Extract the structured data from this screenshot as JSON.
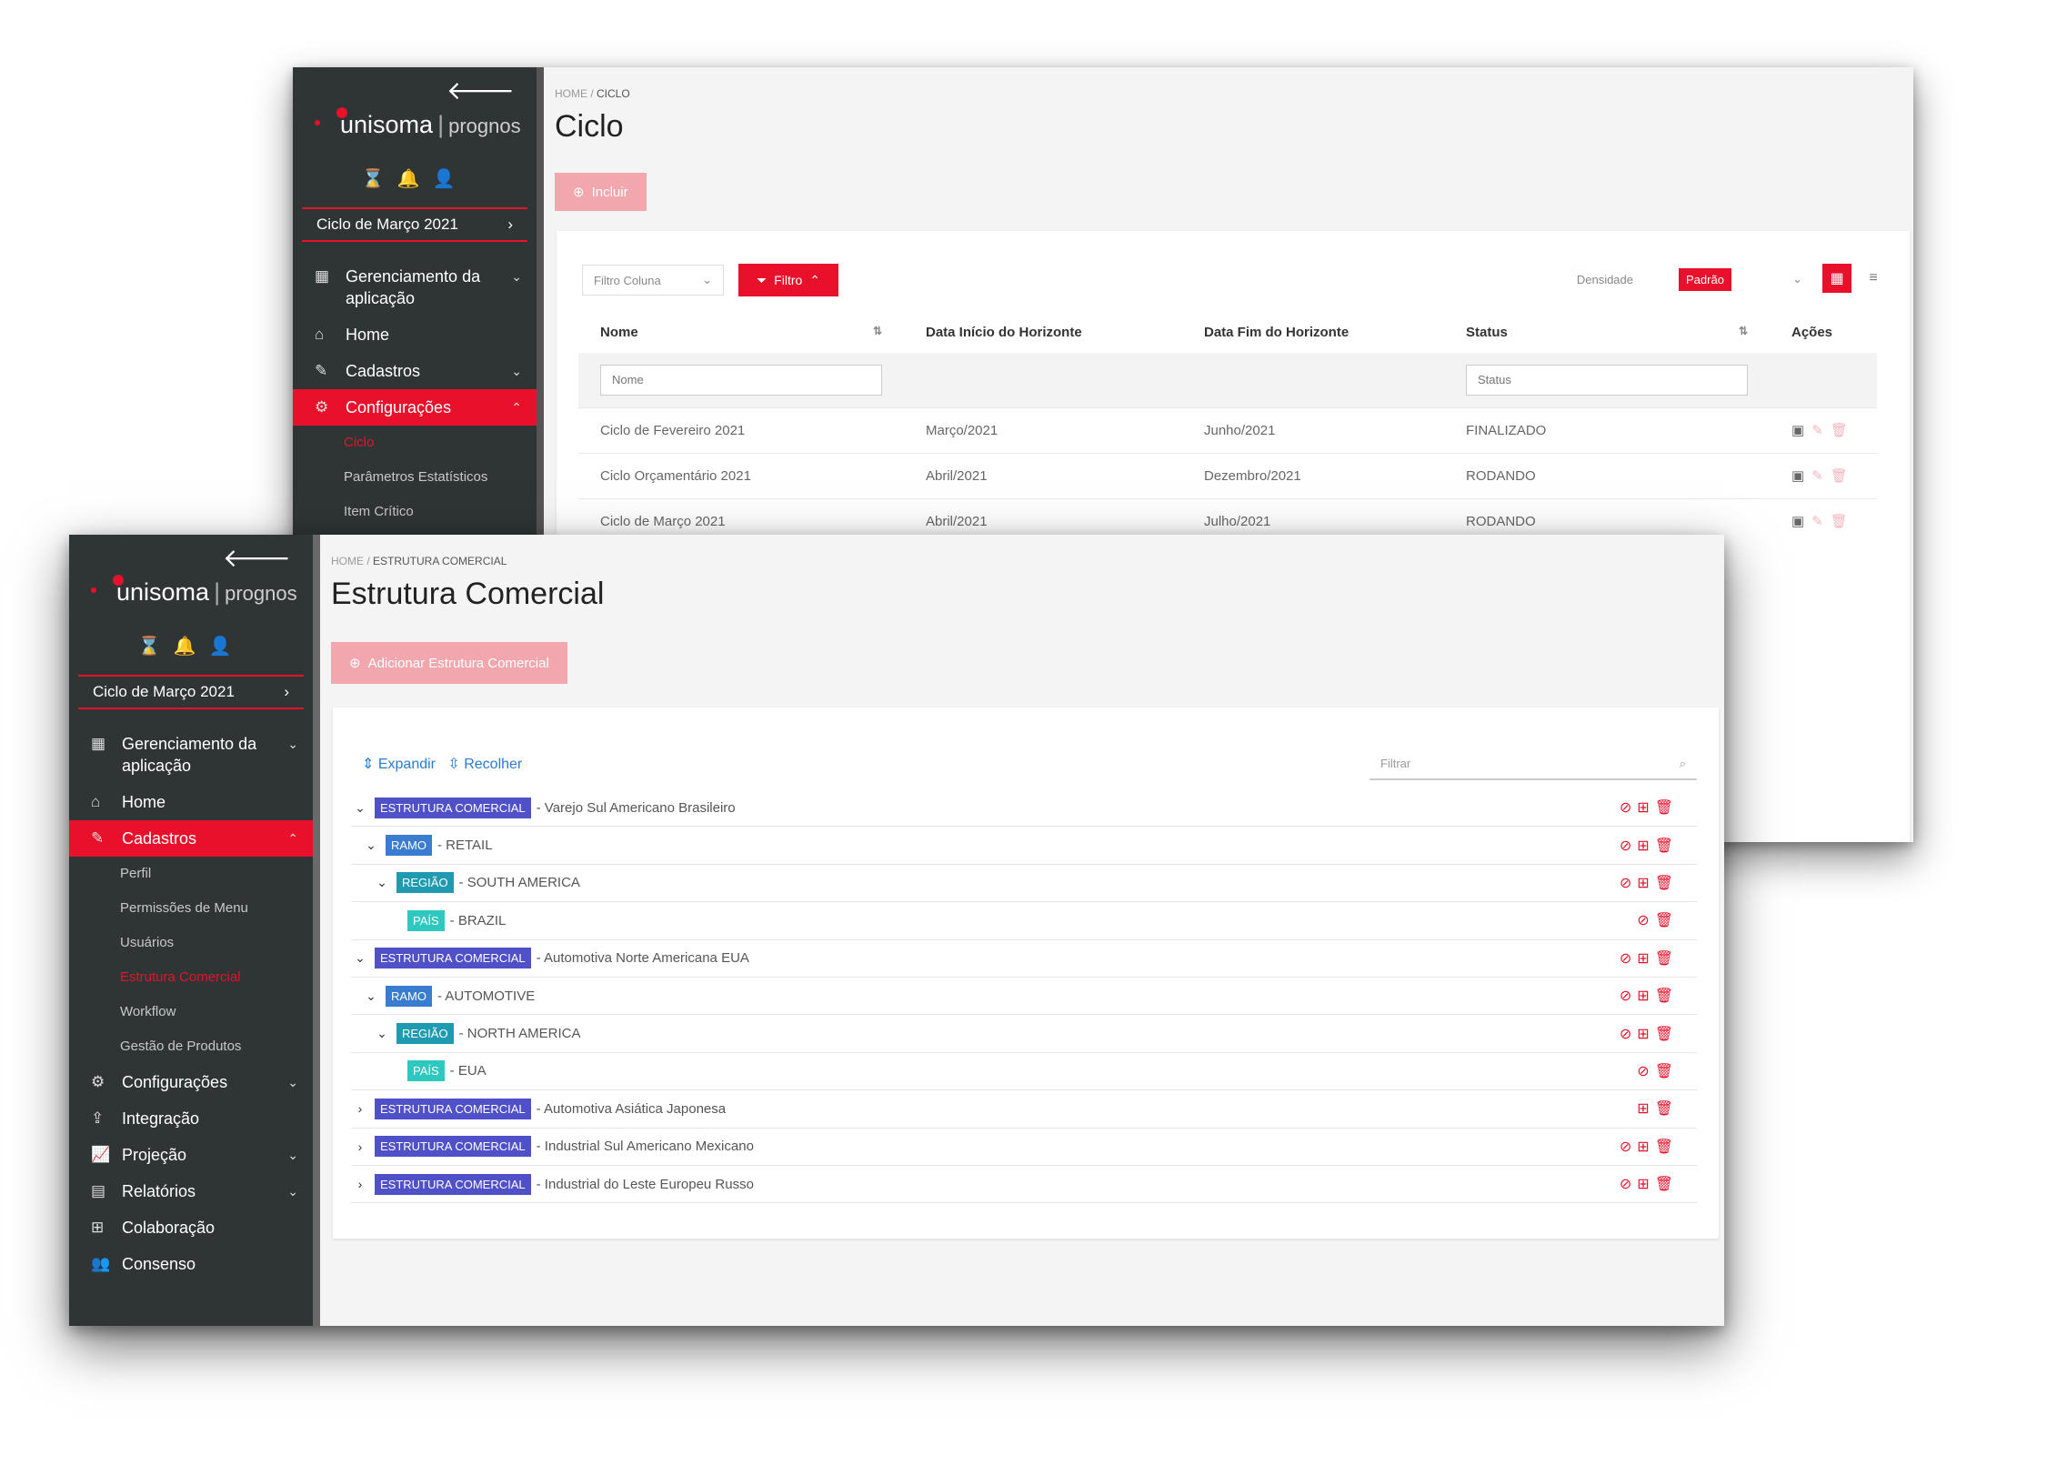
{
  "back_window": {
    "sidebar": {
      "back_icon": "arrow-left-icon",
      "logo": {
        "brand": "unisoma",
        "product": "prognos"
      },
      "cycle": {
        "label": "Ciclo de Março 2021"
      },
      "nav": [
        {
          "label": "Gerenciamento da aplicação",
          "icon": "grid-icon",
          "chevron": "down",
          "active": false
        },
        {
          "label": "Home",
          "icon": "home-icon",
          "active": false
        },
        {
          "label": "Cadastros",
          "icon": "edit-icon",
          "chevron": "down",
          "active": false
        },
        {
          "label": "Configurações",
          "icon": "gears-icon",
          "chevron": "up",
          "active": true
        }
      ],
      "sub_items": [
        "Ciclo",
        "Parâmetros Estatísticos",
        "Item Crítico"
      ]
    },
    "breadcrumb": {
      "home": "HOME",
      "current": "CICLO"
    },
    "title": "Ciclo",
    "add_button": "Incluir",
    "toolbar": {
      "column_filter": "Filtro Coluna",
      "filter_button": "Filtro",
      "density_label": "Densidade",
      "density_value": "Padrão"
    },
    "table": {
      "headers": [
        "Nome",
        "Data Início do Horizonte",
        "Data Fim do Horizonte",
        "Status",
        "Ações"
      ],
      "filter_placeholders": {
        "name": "Nome",
        "status": "Status"
      },
      "rows": [
        {
          "name": "Ciclo de Fevereiro 2021",
          "start": "Março/2021",
          "end": "Junho/2021",
          "status": "FINALIZADO"
        },
        {
          "name": "Ciclo Orçamentário 2021",
          "start": "Abril/2021",
          "end": "Dezembro/2021",
          "status": "RODANDO"
        },
        {
          "name": "Ciclo de Março 2021",
          "start": "Abril/2021",
          "end": "Julho/2021",
          "status": "RODANDO"
        }
      ]
    }
  },
  "front_window": {
    "sidebar": {
      "back_icon": "arrow-left-icon",
      "logo": {
        "brand": "unisoma",
        "product": "prognos"
      },
      "cycle": {
        "label": "Ciclo de Março 2021"
      },
      "nav_top": [
        {
          "label": "Gerenciamento da aplicação",
          "icon": "grid-icon"
        },
        {
          "label": "Home",
          "icon": "home-icon"
        },
        {
          "label": "Cadastros",
          "icon": "edit-icon"
        }
      ],
      "sub_items": [
        "Perfil",
        "Permissões de Menu",
        "Usuários",
        "Estrutura Comercial",
        "Workflow",
        "Gestão de Produtos"
      ],
      "nav_bottom": [
        {
          "label": "Configurações",
          "icon": "gears-icon"
        },
        {
          "label": "Integração",
          "icon": "upload-icon"
        },
        {
          "label": "Projeção",
          "icon": "chart-icon"
        },
        {
          "label": "Relatórios",
          "icon": "document-icon"
        },
        {
          "label": "Colaboração",
          "icon": "sitemap-icon"
        },
        {
          "label": "Consenso",
          "icon": "users-icon"
        }
      ]
    },
    "breadcrumb": {
      "home": "HOME",
      "current": "ESTRUTURA COMERCIAL"
    },
    "title": "Estrutura Comercial",
    "add_button": "Adicionar Estrutura Comercial",
    "tree_tools": {
      "expand": "Expandir",
      "collapse": "Recolher",
      "filter_placeholder": "Filtrar"
    },
    "tree": [
      {
        "level": 0,
        "toggle": "⌄",
        "tag": "ESTRUTURA COMERCIAL",
        "type": "estrutura",
        "text": "- Varejo Sul Americano Brasileiro",
        "actions": [
          "block",
          "add",
          "delete"
        ]
      },
      {
        "level": 1,
        "toggle": "⌄",
        "tag": "RAMO",
        "type": "ramo",
        "text": "- RETAIL",
        "actions": [
          "block",
          "add",
          "delete"
        ]
      },
      {
        "level": 2,
        "toggle": "⌄",
        "tag": "REGIÃO",
        "type": "regiao",
        "text": "- SOUTH AMERICA",
        "actions": [
          "block",
          "add",
          "delete"
        ]
      },
      {
        "level": 3,
        "toggle": "",
        "tag": "PAÍS",
        "type": "pais",
        "text": "- BRAZIL",
        "actions": [
          "block",
          "delete"
        ]
      },
      {
        "level": 0,
        "toggle": "⌄",
        "tag": "ESTRUTURA COMERCIAL",
        "type": "estrutura",
        "text": "- Automotiva Norte Americana EUA",
        "actions": [
          "block",
          "add",
          "delete"
        ]
      },
      {
        "level": 1,
        "toggle": "⌄",
        "tag": "RAMO",
        "type": "ramo",
        "text": "- AUTOMOTIVE",
        "actions": [
          "block",
          "add",
          "delete"
        ]
      },
      {
        "level": 2,
        "toggle": "⌄",
        "tag": "REGIÃO",
        "type": "regiao",
        "text": "- NORTH AMERICA",
        "actions": [
          "block",
          "add",
          "delete"
        ]
      },
      {
        "level": 3,
        "toggle": "",
        "tag": "PAÍS",
        "type": "pais",
        "text": "- EUA",
        "actions": [
          "block",
          "delete"
        ]
      },
      {
        "level": 0,
        "toggle": "›",
        "tag": "ESTRUTURA COMERCIAL",
        "type": "estrutura",
        "text": "- Automotiva Asiática Japonesa",
        "actions": [
          "add",
          "delete"
        ]
      },
      {
        "level": 0,
        "toggle": "›",
        "tag": "ESTRUTURA COMERCIAL",
        "type": "estrutura",
        "text": "- Industrial Sul Americano Mexicano",
        "actions": [
          "block",
          "add",
          "delete"
        ]
      },
      {
        "level": 0,
        "toggle": "›",
        "tag": "ESTRUTURA COMERCIAL",
        "type": "estrutura",
        "text": "- Industrial do Leste Europeu Russo",
        "actions": [
          "block",
          "add",
          "delete"
        ]
      }
    ]
  },
  "colors": {
    "accent": "#e8102a",
    "sidebar": "#2f3535"
  }
}
